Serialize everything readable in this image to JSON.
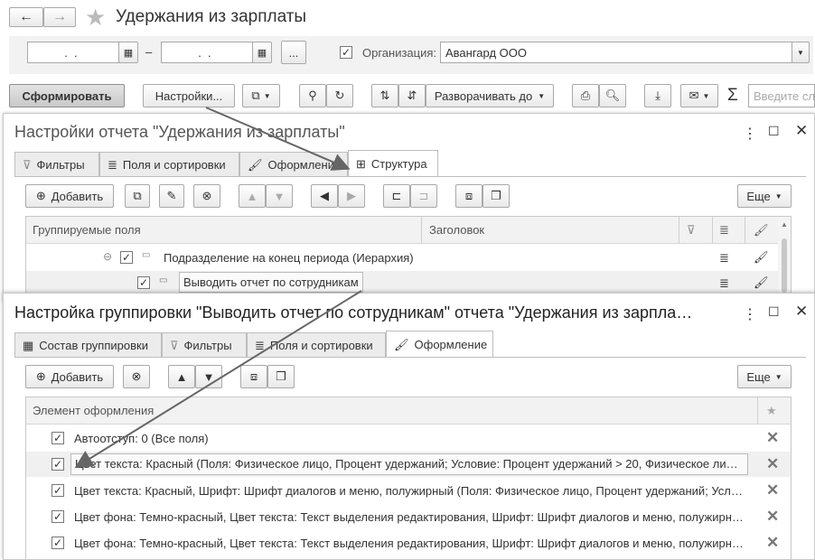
{
  "main": {
    "title": "Удержания из зарплаты",
    "date_from": "  .  .",
    "date_to": "  .  .",
    "dash": "–",
    "dots_label": "...",
    "org_label": "Организация:",
    "org_value": "Авангард ООО",
    "generate_label": "Сформировать",
    "settings_label": "Настройки...",
    "expand_label": "Разворачивать до",
    "search_placeholder": "Введите сл",
    "sigma": "Σ"
  },
  "settings_window": {
    "title": "Настройки отчета \"Удержания из зарплаты\"",
    "tabs": [
      "Фильтры",
      "Поля и сортировки",
      "Оформление",
      "Структура"
    ],
    "add_label": "Добавить",
    "more_label": "Еще",
    "columns": [
      "Группируемые поля",
      "Заголовок"
    ],
    "rows": [
      "Подразделение на конец периода (Иерархия)",
      "Выводить отчет по сотрудникам"
    ]
  },
  "grouping_window": {
    "title": "Настройка группировки \"Выводить отчет по сотрудникам\" отчета \"Удержания из зарпла…",
    "tabs": [
      "Состав группировки",
      "Фильтры",
      "Поля и сортировки",
      "Оформление"
    ],
    "add_label": "Добавить",
    "more_label": "Еще",
    "column": "Элемент оформления",
    "rows": [
      "Автоотступ: 0 (Все поля)",
      "Цвет текста: Красный (Поля: Физическое лицо, Процент удержаний; Условие: Процент удержаний > 20, Физическое лицо…",
      "Цвет текста: Красный, Шрифт: Шрифт диалогов и меню, полужирный (Поля: Физическое лицо, Процент удержаний; Услов…",
      "Цвет фона: Темно-красный, Цвет текста: Текст выделения редактирования, Шрифт: Шрифт диалогов и меню, полужирный …",
      "Цвет фона: Темно-красный, Цвет текста: Текст выделения редактирования, Шрифт: Шрифт диалогов и меню, полужирный …"
    ]
  },
  "icons": {
    "back": "back-arrow-icon",
    "forward": "forward-arrow-icon",
    "star": "favorite-star-icon"
  },
  "colors": {
    "arrow": "#666666",
    "selected_row": "#f0f0f0"
  }
}
